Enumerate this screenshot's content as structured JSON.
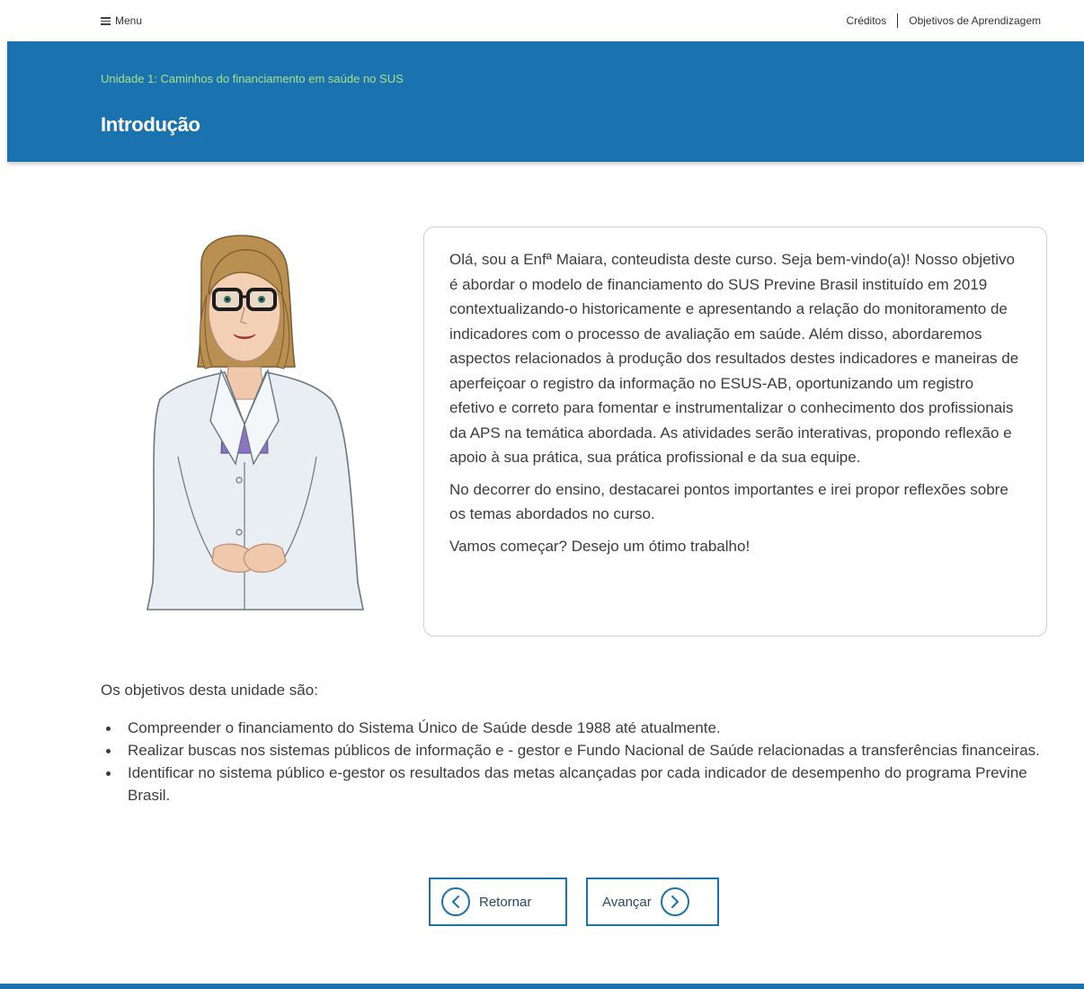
{
  "topbar": {
    "menu_label": "Menu",
    "credits_label": "Créditos",
    "objectives_label": "Objetivos de Aprendizagem"
  },
  "banner": {
    "unit_title": "Unidade 1: Caminhos do financiamento em saúde no SUS",
    "page_title": "Introdução"
  },
  "speech": {
    "paragraphs": [
      "Olá, sou a Enfª Maiara, conteudista deste curso. Seja bem-vindo(a)! Nosso objetivo é abordar o modelo de financiamento do SUS Previne Brasil instituído em 2019 contextualizando-o historicamente e apresentando a relação do monitoramento de indicadores com o processo de avaliação em saúde. Além disso, abordaremos aspectos relacionados à produção dos resultados destes indicadores e maneiras de aperfeiçoar o registro da informação no ESUS-AB, oportunizando um registro efetivo e correto para fomentar e instrumentalizar o conhecimento dos profissionais da APS na temática abordada. As atividades serão interativas, propondo reflexão e apoio à sua prática, sua prática profissional e da sua equipe.",
      "No decorrer do ensino, destacarei pontos importantes e irei propor reflexões sobre os temas abordados no curso.",
      "Vamos começar? Desejo um ótimo trabalho!"
    ]
  },
  "objectives": {
    "lead": "Os objetivos desta unidade são:",
    "items": [
      "Compreender o financiamento do Sistema Único de Saúde desde 1988 até atualmente.",
      "Realizar buscas nos sistemas públicos de informação e - gestor e Fundo Nacional de Saúde relacionadas a transferências financeiras.",
      "Identificar no sistema público e-gestor os resultados das metas alcançadas por cada indicador de desempenho do programa Previne Brasil."
    ]
  },
  "navigation": {
    "prev_label": "Retornar",
    "next_label": "Avançar"
  },
  "colors": {
    "brand_blue": "#1a73ae",
    "unit_green": "#a6e08a"
  },
  "icons": {
    "menu": "hamburger-icon",
    "prev": "chevron-left-circle-icon",
    "next": "chevron-right-circle-icon"
  }
}
